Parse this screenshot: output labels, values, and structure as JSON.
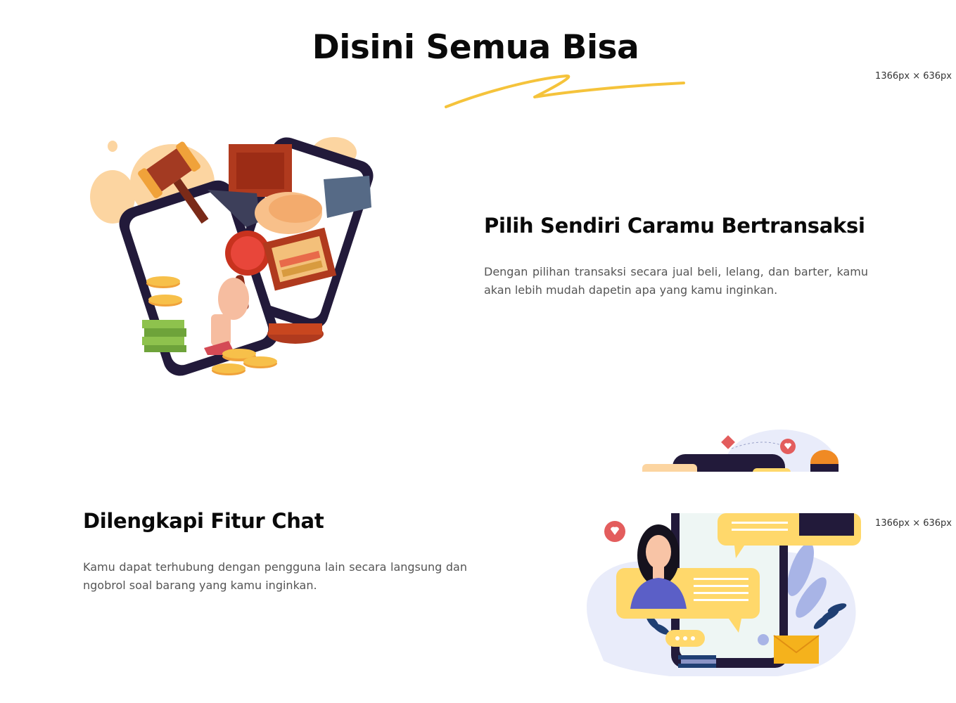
{
  "section": {
    "title": "Disini Semua Bisa",
    "accent_color": "#f5c33b"
  },
  "viewport_labels": [
    "1366px × 636px",
    "1366px × 636px"
  ],
  "features": [
    {
      "title": "Pilih Sendiri Caramu Bertransaksi",
      "description": "Dengan pilihan transaksi secara jual beli, lelang, dan barter, kamu akan lebih mudah dapetin apa yang kamu inginkan.",
      "illustration": "transaction-illustration"
    },
    {
      "title": "Dilengkapi Fitur Chat",
      "description": "Kamu dapat terhubung dengan pengguna lain secara langsung dan ngobrol soal barang yang kamu inginkan.",
      "illustration": "chat-illustration"
    }
  ]
}
